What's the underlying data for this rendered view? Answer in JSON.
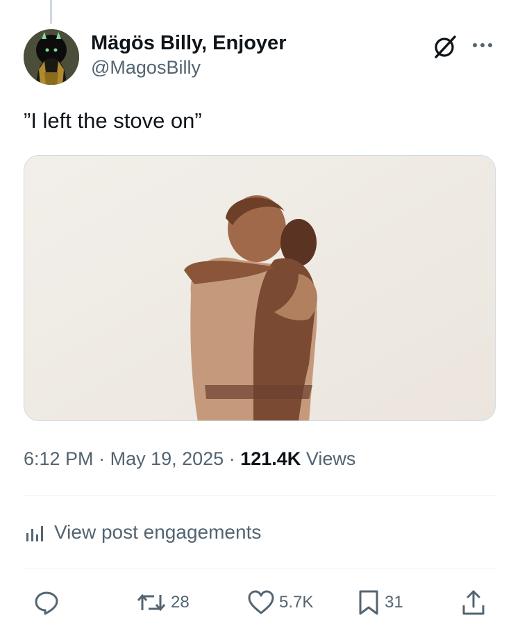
{
  "post": {
    "author": {
      "display_name": "Mägös Billy, Enjoyer",
      "handle": "@MagosBilly",
      "avatar_icon": "helmeted-figure-avatar"
    },
    "text": "”I left the stove on”",
    "media": {
      "kind": "image",
      "description_icon": "embrace-photo"
    },
    "timestamp": {
      "time": "6:12 PM",
      "separator": "·",
      "date": "May 19, 2025",
      "views_count": "121.4K",
      "views_label": "Views"
    },
    "engagements_link": "View post engagements",
    "actions": {
      "reply": {
        "icon": "reply-icon",
        "count": ""
      },
      "repost": {
        "icon": "repost-icon",
        "count": "28"
      },
      "like": {
        "icon": "heart-icon",
        "count": "5.7K"
      },
      "bookmark": {
        "icon": "bookmark-icon",
        "count": "31"
      },
      "share": {
        "icon": "share-icon",
        "count": ""
      }
    }
  },
  "colors": {
    "text_primary": "#0f1419",
    "text_secondary": "#536471",
    "divider": "#eff3f4",
    "media_border": "#cfd9de"
  }
}
